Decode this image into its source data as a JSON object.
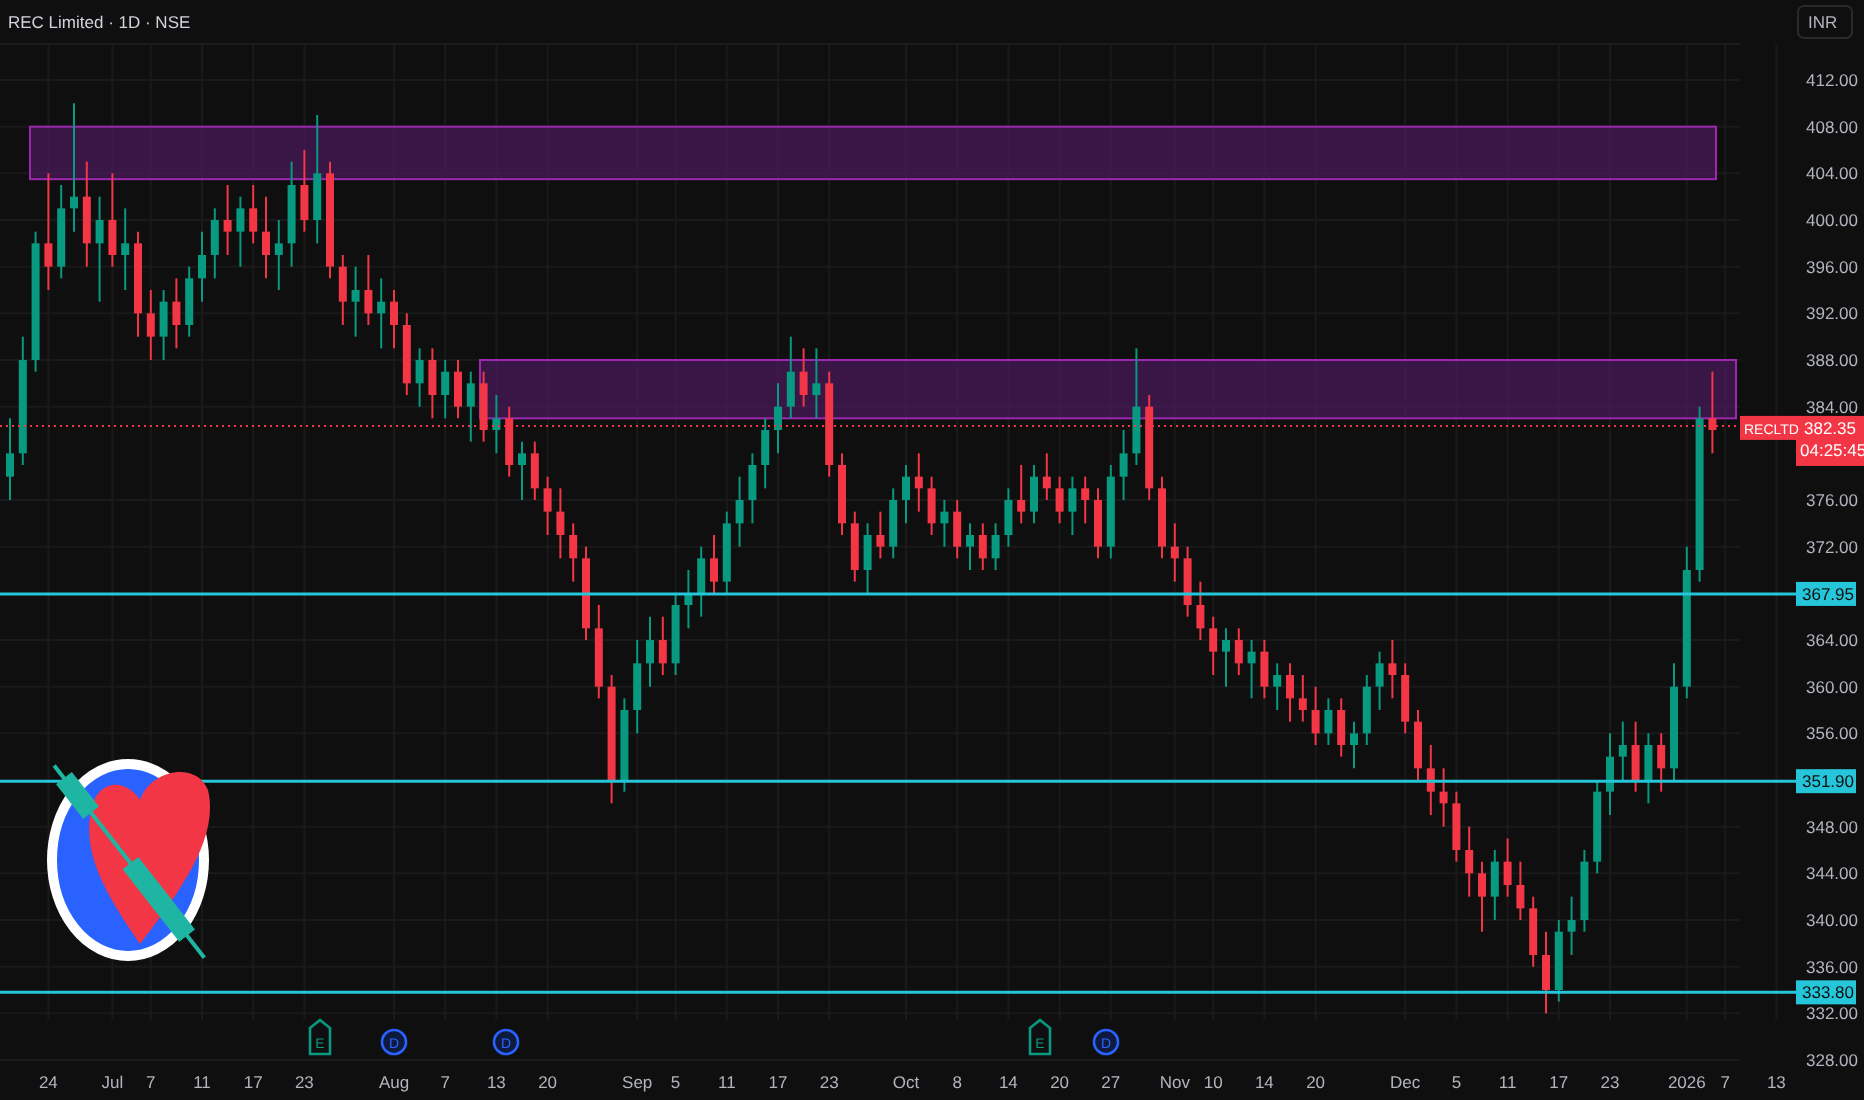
{
  "title": "REC Limited · 1D · NSE",
  "currency_button": "INR",
  "levels": [
    {
      "label": "367.95"
    },
    {
      "label": "351.90"
    },
    {
      "label": "333.80"
    }
  ],
  "current_price": {
    "symbol": "RECLTD",
    "price": "382.35",
    "countdown": "04:25:45"
  },
  "chart_data": {
    "type": "candlestick",
    "yticks": [
      {
        "value": 412,
        "label": "412.00"
      },
      {
        "value": 408,
        "label": "408.00"
      },
      {
        "value": 404,
        "label": "404.00"
      },
      {
        "value": 400,
        "label": "400.00"
      },
      {
        "value": 396,
        "label": "396.00"
      },
      {
        "value": 392,
        "label": "392.00"
      },
      {
        "value": 388,
        "label": "388.00"
      },
      {
        "value": 384,
        "label": "384.00"
      },
      {
        "value": 376,
        "label": "376.00"
      },
      {
        "value": 372,
        "label": "372.00"
      },
      {
        "value": 364,
        "label": "364.00"
      },
      {
        "value": 360,
        "label": "360.00"
      },
      {
        "value": 356,
        "label": "356.00"
      },
      {
        "value": 348,
        "label": "348.00"
      },
      {
        "value": 344,
        "label": "344.00"
      },
      {
        "value": 340,
        "label": "340.00"
      },
      {
        "value": 336,
        "label": "336.00"
      },
      {
        "value": 332,
        "label": "332.00"
      },
      {
        "value": 328,
        "label": "328.00"
      }
    ],
    "ylim": [
      328,
      412
    ],
    "grid": true,
    "categories": [
      null,
      null,
      null,
      "24",
      null,
      null,
      null,
      null,
      "Jul",
      null,
      null,
      "7",
      null,
      null,
      null,
      "11",
      null,
      null,
      null,
      "17",
      null,
      null,
      null,
      "23",
      null,
      null,
      null,
      null,
      null,
      null,
      "Aug",
      null,
      null,
      null,
      "7",
      null,
      null,
      null,
      "13",
      null,
      null,
      null,
      "20",
      null,
      null,
      null,
      null,
      null,
      null,
      "Sep",
      null,
      null,
      "5",
      null,
      null,
      null,
      "11",
      null,
      null,
      null,
      "17",
      null,
      null,
      null,
      "23",
      null,
      null,
      null,
      null,
      null,
      "Oct",
      null,
      null,
      null,
      "8",
      null,
      null,
      null,
      "14",
      null,
      null,
      null,
      "20",
      null,
      null,
      null,
      "27",
      null,
      null,
      null,
      null,
      "Nov",
      null,
      null,
      "10",
      null,
      null,
      null,
      "14",
      null,
      null,
      null,
      "20",
      null,
      null,
      null,
      null,
      null,
      null,
      "Dec",
      null,
      null,
      null,
      "5",
      null,
      null,
      null,
      "11",
      null,
      null,
      null,
      "17",
      null,
      null,
      null,
      "23",
      null,
      null,
      null,
      null,
      null,
      "2026",
      null,
      null,
      "7",
      null,
      null,
      null,
      "13"
    ],
    "ohlc": [
      [
        378,
        383,
        376,
        380
      ],
      [
        380,
        390,
        379,
        388
      ],
      [
        388,
        399,
        387,
        398
      ],
      [
        398,
        404,
        394,
        396
      ],
      [
        396,
        403,
        395,
        401
      ],
      [
        401,
        410,
        399,
        402
      ],
      [
        402,
        405,
        396,
        398
      ],
      [
        398,
        402,
        393,
        400
      ],
      [
        400,
        404,
        396,
        397
      ],
      [
        397,
        401,
        394,
        398
      ],
      [
        398,
        399,
        390,
        392
      ],
      [
        392,
        394,
        388,
        390
      ],
      [
        390,
        394,
        388,
        393
      ],
      [
        393,
        395,
        389,
        391
      ],
      [
        391,
        396,
        390,
        395
      ],
      [
        395,
        399,
        393,
        397
      ],
      [
        397,
        401,
        395,
        400
      ],
      [
        400,
        403,
        397,
        399
      ],
      [
        399,
        402,
        396,
        401
      ],
      [
        401,
        403,
        398,
        399
      ],
      [
        399,
        402,
        395,
        397
      ],
      [
        397,
        400,
        394,
        398
      ],
      [
        398,
        405,
        396,
        403
      ],
      [
        403,
        406,
        399,
        400
      ],
      [
        400,
        409,
        398,
        404
      ],
      [
        404,
        405,
        395,
        396
      ],
      [
        396,
        397,
        391,
        393
      ],
      [
        393,
        396,
        390,
        394
      ],
      [
        394,
        397,
        391,
        392
      ],
      [
        392,
        395,
        389,
        393
      ],
      [
        393,
        394,
        389,
        391
      ],
      [
        391,
        392,
        385,
        386
      ],
      [
        386,
        389,
        384,
        388
      ],
      [
        388,
        389,
        383,
        385
      ],
      [
        385,
        388,
        383,
        387
      ],
      [
        387,
        388,
        383,
        384
      ],
      [
        384,
        387,
        381,
        386
      ],
      [
        386,
        387,
        381,
        382
      ],
      [
        382,
        385,
        380,
        383
      ],
      [
        383,
        384,
        378,
        379
      ],
      [
        379,
        381,
        376,
        380
      ],
      [
        380,
        381,
        376,
        377
      ],
      [
        377,
        378,
        373,
        375
      ],
      [
        375,
        377,
        371,
        373
      ],
      [
        373,
        374,
        369,
        371
      ],
      [
        371,
        372,
        364,
        365
      ],
      [
        365,
        367,
        359,
        360
      ],
      [
        360,
        361,
        350,
        352
      ],
      [
        352,
        359,
        351,
        358
      ],
      [
        358,
        364,
        356,
        362
      ],
      [
        362,
        366,
        360,
        364
      ],
      [
        364,
        366,
        361,
        362
      ],
      [
        362,
        368,
        361,
        367
      ],
      [
        367,
        370,
        365,
        368
      ],
      [
        368,
        372,
        366,
        371
      ],
      [
        371,
        373,
        368,
        369
      ],
      [
        369,
        375,
        368,
        374
      ],
      [
        374,
        378,
        372,
        376
      ],
      [
        376,
        380,
        374,
        379
      ],
      [
        379,
        383,
        377,
        382
      ],
      [
        382,
        386,
        380,
        384
      ],
      [
        384,
        390,
        383,
        387
      ],
      [
        387,
        389,
        384,
        385
      ],
      [
        385,
        389,
        383,
        386
      ],
      [
        386,
        387,
        378,
        379
      ],
      [
        379,
        380,
        373,
        374
      ],
      [
        374,
        375,
        369,
        370
      ],
      [
        370,
        374,
        368,
        373
      ],
      [
        373,
        375,
        371,
        372
      ],
      [
        372,
        377,
        371,
        376
      ],
      [
        376,
        379,
        374,
        378
      ],
      [
        378,
        380,
        375,
        377
      ],
      [
        377,
        378,
        373,
        374
      ],
      [
        374,
        376,
        372,
        375
      ],
      [
        375,
        376,
        371,
        372
      ],
      [
        372,
        374,
        370,
        373
      ],
      [
        373,
        374,
        370,
        371
      ],
      [
        371,
        374,
        370,
        373
      ],
      [
        373,
        377,
        372,
        376
      ],
      [
        376,
        379,
        374,
        375
      ],
      [
        375,
        379,
        374,
        378
      ],
      [
        378,
        380,
        376,
        377
      ],
      [
        377,
        378,
        374,
        375
      ],
      [
        375,
        378,
        373,
        377
      ],
      [
        377,
        378,
        374,
        376
      ],
      [
        376,
        377,
        371,
        372
      ],
      [
        372,
        379,
        371,
        378
      ],
      [
        378,
        382,
        376,
        380
      ],
      [
        380,
        389,
        379,
        384
      ],
      [
        384,
        385,
        376,
        377
      ],
      [
        377,
        378,
        371,
        372
      ],
      [
        372,
        374,
        369,
        371
      ],
      [
        371,
        372,
        366,
        367
      ],
      [
        367,
        369,
        364,
        365
      ],
      [
        365,
        366,
        361,
        363
      ],
      [
        363,
        365,
        360,
        364
      ],
      [
        364,
        365,
        361,
        362
      ],
      [
        362,
        364,
        359,
        363
      ],
      [
        363,
        364,
        359,
        360
      ],
      [
        360,
        362,
        358,
        361
      ],
      [
        361,
        362,
        357,
        359
      ],
      [
        359,
        361,
        357,
        358
      ],
      [
        358,
        360,
        355,
        356
      ],
      [
        356,
        359,
        355,
        358
      ],
      [
        358,
        359,
        354,
        355
      ],
      [
        355,
        357,
        353,
        356
      ],
      [
        356,
        361,
        355,
        360
      ],
      [
        360,
        363,
        358,
        362
      ],
      [
        362,
        364,
        359,
        361
      ],
      [
        361,
        362,
        356,
        357
      ],
      [
        357,
        358,
        352,
        353
      ],
      [
        353,
        355,
        349,
        351
      ],
      [
        351,
        353,
        348,
        350
      ],
      [
        350,
        351,
        345,
        346
      ],
      [
        346,
        348,
        342,
        344
      ],
      [
        344,
        345,
        339,
        342
      ],
      [
        342,
        346,
        340,
        345
      ],
      [
        345,
        347,
        342,
        343
      ],
      [
        343,
        345,
        340,
        341
      ],
      [
        341,
        342,
        336,
        337
      ],
      [
        337,
        339,
        332,
        334
      ],
      [
        334,
        340,
        333,
        339
      ],
      [
        339,
        342,
        337,
        340
      ],
      [
        340,
        346,
        339,
        345
      ],
      [
        345,
        352,
        344,
        351
      ],
      [
        351,
        356,
        349,
        354
      ],
      [
        354,
        357,
        352,
        355
      ],
      [
        355,
        357,
        351,
        352
      ],
      [
        352,
        356,
        350,
        355
      ],
      [
        355,
        356,
        351,
        353
      ],
      [
        353,
        362,
        352,
        360
      ],
      [
        360,
        372,
        359,
        370
      ],
      [
        370,
        384,
        369,
        383
      ],
      [
        383,
        387,
        380,
        382
      ],
      null,
      null,
      null,
      null,
      null
    ]
  },
  "events": [
    {
      "kind": "earnings",
      "label": "E"
    },
    {
      "kind": "dividend",
      "label": "D"
    },
    {
      "kind": "dividend",
      "label": "D"
    },
    {
      "kind": "earnings",
      "label": "E"
    },
    {
      "kind": "dividend",
      "label": "D"
    }
  ]
}
